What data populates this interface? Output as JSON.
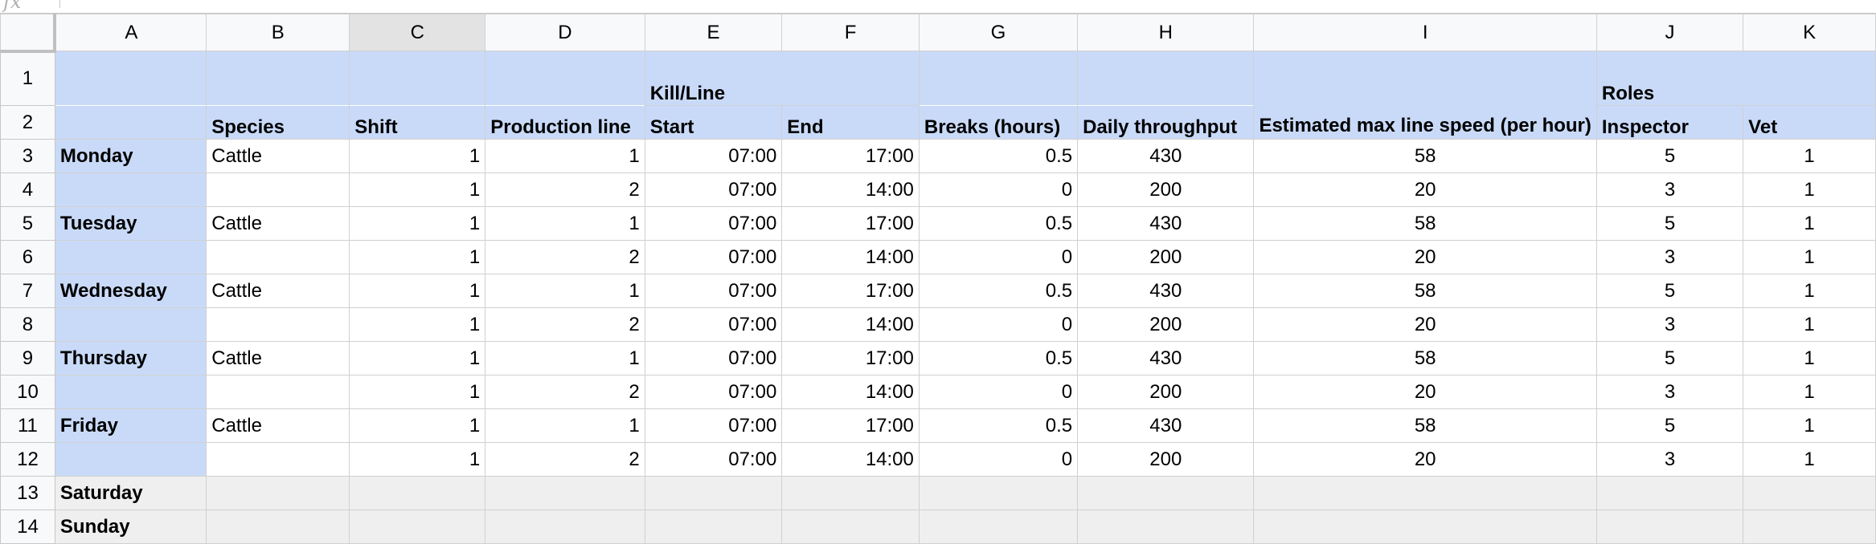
{
  "formula_bar": {
    "fx": "fx"
  },
  "columns": [
    "A",
    "B",
    "C",
    "D",
    "E",
    "F",
    "G",
    "H",
    "I",
    "J",
    "K"
  ],
  "row_numbers": [
    "1",
    "2",
    "3",
    "4",
    "5",
    "6",
    "7",
    "8",
    "9",
    "10",
    "11",
    "12",
    "13",
    "14"
  ],
  "header_row1": {
    "kill_line": "Kill/Line",
    "estimated": "Estimated max line speed (per hour)",
    "roles": "Roles"
  },
  "header_row2": {
    "species": "Species",
    "shift": "Shift",
    "production_line": "Production line",
    "start": "Start",
    "end": "End",
    "breaks": "Breaks (hours)",
    "daily_throughput": "Daily throughput",
    "inspector": "Inspector",
    "vet": "Vet"
  },
  "rows": [
    {
      "day": "Monday",
      "species": "Cattle",
      "shift": "1",
      "line": "1",
      "start": "07:00",
      "end": "17:00",
      "breaks": "0.5",
      "throughput": "430",
      "speed": "58",
      "inspector": "5",
      "vet": "1"
    },
    {
      "day": "",
      "species": "",
      "shift": "1",
      "line": "2",
      "start": "07:00",
      "end": "14:00",
      "breaks": "0",
      "throughput": "200",
      "speed": "20",
      "inspector": "3",
      "vet": "1"
    },
    {
      "day": "Tuesday",
      "species": "Cattle",
      "shift": "1",
      "line": "1",
      "start": "07:00",
      "end": "17:00",
      "breaks": "0.5",
      "throughput": "430",
      "speed": "58",
      "inspector": "5",
      "vet": "1"
    },
    {
      "day": "",
      "species": "",
      "shift": "1",
      "line": "2",
      "start": "07:00",
      "end": "14:00",
      "breaks": "0",
      "throughput": "200",
      "speed": "20",
      "inspector": "3",
      "vet": "1"
    },
    {
      "day": "Wednesday",
      "species": "Cattle",
      "shift": "1",
      "line": "1",
      "start": "07:00",
      "end": "17:00",
      "breaks": "0.5",
      "throughput": "430",
      "speed": "58",
      "inspector": "5",
      "vet": "1"
    },
    {
      "day": "",
      "species": "",
      "shift": "1",
      "line": "2",
      "start": "07:00",
      "end": "14:00",
      "breaks": "0",
      "throughput": "200",
      "speed": "20",
      "inspector": "3",
      "vet": "1"
    },
    {
      "day": "Thursday",
      "species": "Cattle",
      "shift": "1",
      "line": "1",
      "start": "07:00",
      "end": "17:00",
      "breaks": "0.5",
      "throughput": "430",
      "speed": "58",
      "inspector": "5",
      "vet": "1"
    },
    {
      "day": "",
      "species": "",
      "shift": "1",
      "line": "2",
      "start": "07:00",
      "end": "14:00",
      "breaks": "0",
      "throughput": "200",
      "speed": "20",
      "inspector": "3",
      "vet": "1"
    },
    {
      "day": "Friday",
      "species": "Cattle",
      "shift": "1",
      "line": "1",
      "start": "07:00",
      "end": "17:00",
      "breaks": "0.5",
      "throughput": "430",
      "speed": "58",
      "inspector": "5",
      "vet": "1"
    },
    {
      "day": "",
      "species": "",
      "shift": "1",
      "line": "2",
      "start": "07:00",
      "end": "14:00",
      "breaks": "0",
      "throughput": "200",
      "speed": "20",
      "inspector": "3",
      "vet": "1"
    }
  ],
  "weekend": [
    "Saturday",
    "Sunday"
  ],
  "colors": {
    "header_blue": "#c9daf8",
    "weekend_gray": "#efefef",
    "selected_column": "#e3e3e3"
  }
}
